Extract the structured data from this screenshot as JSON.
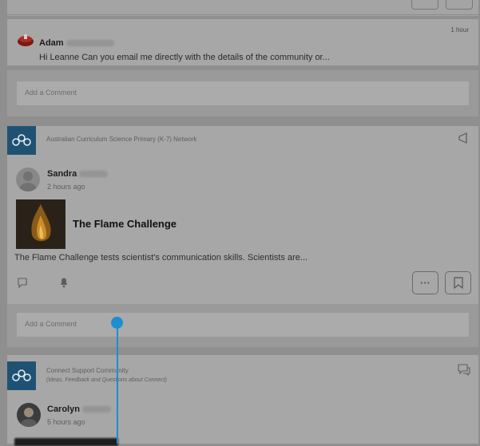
{
  "post1": {
    "author_first": "Adam",
    "time": "1 hour",
    "message": "Hi Leanne Can you email me directly with the details of the community or...",
    "comment_placeholder": "Add a Comment"
  },
  "post2": {
    "network": "Australian Curriculum Science Primary (K-7) Network",
    "author_first": "Sandra",
    "time": "2 hours ago",
    "title": "The Flame Challenge",
    "excerpt": "The Flame Challenge tests scientist's communication skills. Scientists are...",
    "comment_placeholder": "Add a Comment",
    "more_label": "···"
  },
  "post3": {
    "network": "Connect Support Community",
    "subtitle": "(Ideas, Feedback and Questions about Connect)",
    "author_first": "Carolyn",
    "time": "5 hours ago"
  },
  "colors": {
    "network_icon": "#1f5272",
    "cursor": "#1b8fd0"
  }
}
